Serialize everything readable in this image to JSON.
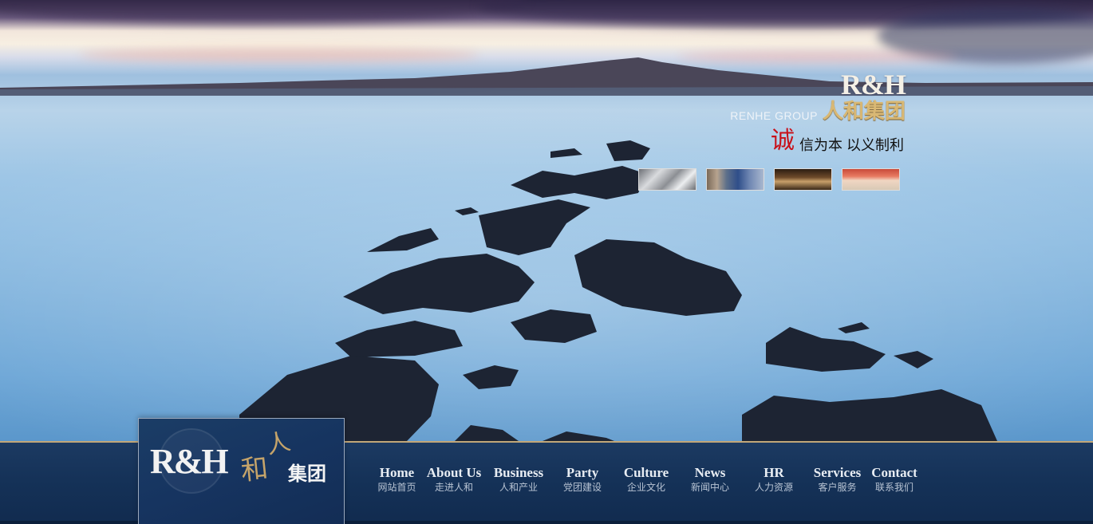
{
  "brand": {
    "logo": "R&H",
    "english": "RENHE GROUP",
    "chinese": "人和集团"
  },
  "slogan": {
    "first_char": "诚",
    "rest": "信为本 以义制利"
  },
  "thumbnails": [
    {
      "name": "steel-coils-thumb"
    },
    {
      "name": "buildings-thumb"
    },
    {
      "name": "shopfront-thumb"
    },
    {
      "name": "storefront-sign-thumb"
    }
  ],
  "logo_box": {
    "rh": "R&H",
    "ren": "人",
    "he": "和",
    "jituan": "集团"
  },
  "nav": {
    "items": [
      {
        "en": "Home",
        "cn": "网站首页"
      },
      {
        "en": "About Us",
        "cn": "走进人和"
      },
      {
        "en": "Business",
        "cn": "人和产业"
      },
      {
        "en": "Party",
        "cn": "党团建设"
      },
      {
        "en": "Culture",
        "cn": "企业文化"
      },
      {
        "en": "News",
        "cn": "新闻中心"
      },
      {
        "en": "HR",
        "cn": "人力资源"
      },
      {
        "en": "Services",
        "cn": "客户服务"
      },
      {
        "en": "Contact",
        "cn": "联系我们"
      }
    ]
  },
  "colors": {
    "accent_gold": "#c5a46a",
    "nav_blue": "#153258",
    "slogan_red": "#c8111a"
  }
}
